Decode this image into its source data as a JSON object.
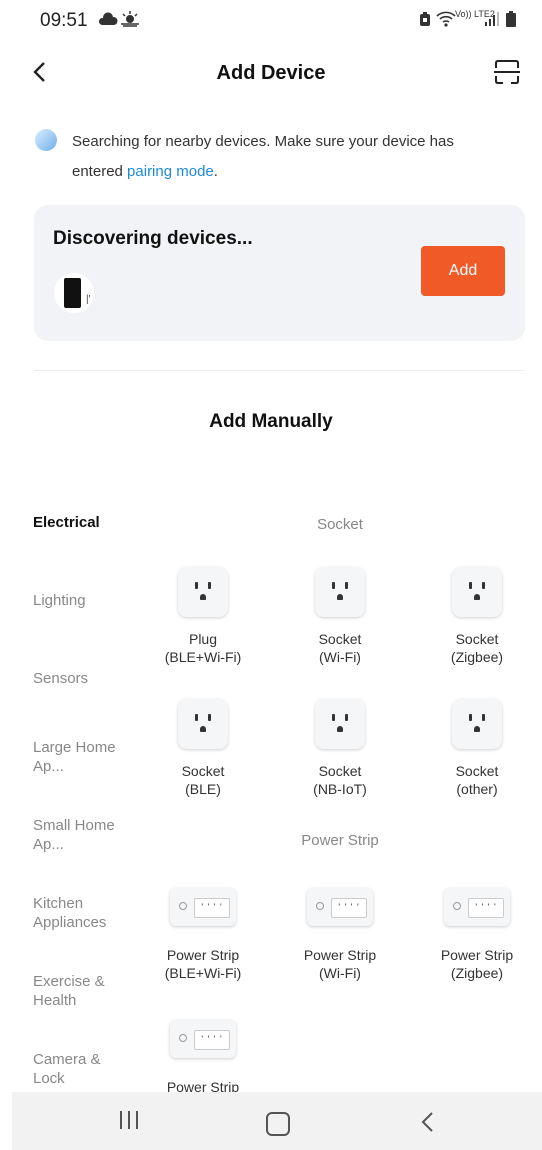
{
  "status_bar": {
    "time": "09:51",
    "left_icons": [
      "cloud-icon",
      "weather-icon"
    ],
    "right_icons": [
      "alarm-icon",
      "wifi-icon",
      "volte-icon",
      "signal-icon",
      "battery-icon"
    ],
    "network_text": "Vo)) LTE2"
  },
  "header": {
    "title": "Add Device",
    "back_icon": "chevron-left-icon",
    "scan_icon": "scan-icon"
  },
  "searching": {
    "text": "Searching for nearby devices. Make sure your device has entered ",
    "link": "pairing mode",
    "suffix": "."
  },
  "discovering": {
    "title": "Discovering devices...",
    "add_label": "Add",
    "device_glyph": "|'"
  },
  "add_manually": {
    "title": "Add Manually"
  },
  "categories": [
    "Electrical",
    "Lighting",
    "Sensors",
    "Large Home Ap...",
    "Small Home Ap...",
    "Kitchen Appliances",
    "Exercise & Health",
    "Camera & Lock"
  ],
  "sections": {
    "socket": {
      "title": "Socket",
      "items": [
        {
          "line1": "Plug",
          "line2": "(BLE+Wi-Fi)"
        },
        {
          "line1": "Socket",
          "line2": "(Wi-Fi)"
        },
        {
          "line1": "Socket",
          "line2": "(Zigbee)"
        },
        {
          "line1": "Socket",
          "line2": "(BLE)"
        },
        {
          "line1": "Socket",
          "line2": "(NB-IoT)"
        },
        {
          "line1": "Socket",
          "line2": "(other)"
        }
      ]
    },
    "power_strip": {
      "title": "Power Strip",
      "items": [
        {
          "line1": "Power Strip",
          "line2": "(BLE+Wi-Fi)"
        },
        {
          "line1": "Power Strip",
          "line2": "(Wi-Fi)"
        },
        {
          "line1": "Power Strip",
          "line2": "(Zigbee)"
        },
        {
          "line1": "Power Strip",
          "line2": ""
        }
      ]
    }
  },
  "colors": {
    "accent": "#ef5a27",
    "link": "#1e8ad6",
    "card_bg": "#f1f3f6"
  }
}
